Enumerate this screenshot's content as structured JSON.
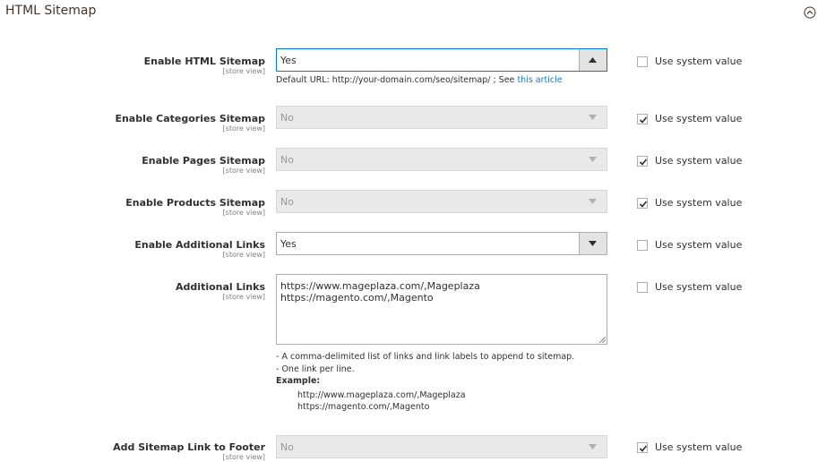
{
  "section": {
    "title": "HTML Sitemap"
  },
  "rows": [
    {
      "label": "Enable HTML Sitemap",
      "scope": "[store view]",
      "value": "Yes",
      "use_system": "Use system value"
    },
    {
      "label": "Enable Categories Sitemap",
      "scope": "[store view]",
      "value": "No",
      "use_system": "Use system value"
    },
    {
      "label": "Enable Pages Sitemap",
      "scope": "[store view]",
      "value": "No",
      "use_system": "Use system value"
    },
    {
      "label": "Enable Products Sitemap",
      "scope": "[store view]",
      "value": "No",
      "use_system": "Use system value"
    },
    {
      "label": "Enable Additional Links",
      "scope": "[store view]",
      "value": "Yes",
      "use_system": "Use system value"
    },
    {
      "label": "Additional Links",
      "scope": "[store view]",
      "lines": [
        "https://www.mageplaza.com/,Mageplaza",
        "https://magento.com/,Magento"
      ],
      "use_system": "Use system value"
    },
    {
      "label": "Add Sitemap Link to Footer",
      "scope": "[store view]",
      "value": "No",
      "use_system": "Use system value"
    }
  ],
  "default_url_note": {
    "text": "Default URL: http://your-domain.com/seo/sitemap/ ; See ",
    "link": "this article"
  },
  "additional_links_comment": {
    "line1": "- A comma-delimited list of links and link labels to append to sitemap.",
    "line2": "- One link per line.",
    "example_label": "Example:",
    "examples": [
      "http://www.mageplaza.com/,Mageplaza",
      "https://magento.com/,Magento"
    ]
  }
}
